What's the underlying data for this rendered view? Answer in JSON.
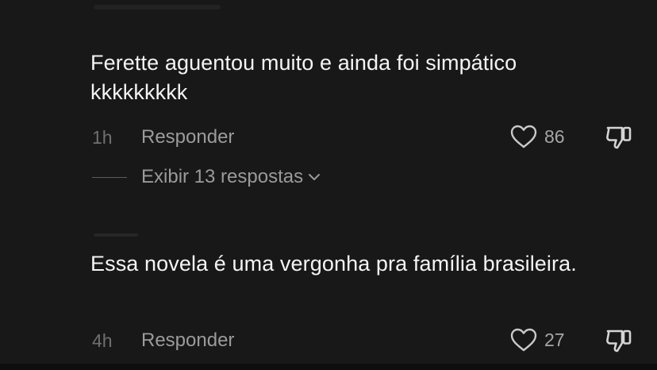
{
  "comments": [
    {
      "text": "Ferette aguentou muito e ainda foi simpático kkkkkkkkk",
      "time": "1h",
      "reply_label": "Responder",
      "likes": "86",
      "replies_label": "Exibir 13 respostas"
    },
    {
      "text": "Essa novela é uma vergonha pra família brasileira.",
      "time": "4h",
      "reply_label": "Responder",
      "likes": "27"
    }
  ],
  "icons": {
    "like": "heart-outline-icon",
    "dislike": "thumbs-down-icon",
    "expand": "chevron-down-icon"
  },
  "colors": {
    "background": "#181818",
    "text_primary": "#f4f4f4",
    "text_secondary": "#9b9b9b",
    "text_muted": "#6f6f6f"
  }
}
